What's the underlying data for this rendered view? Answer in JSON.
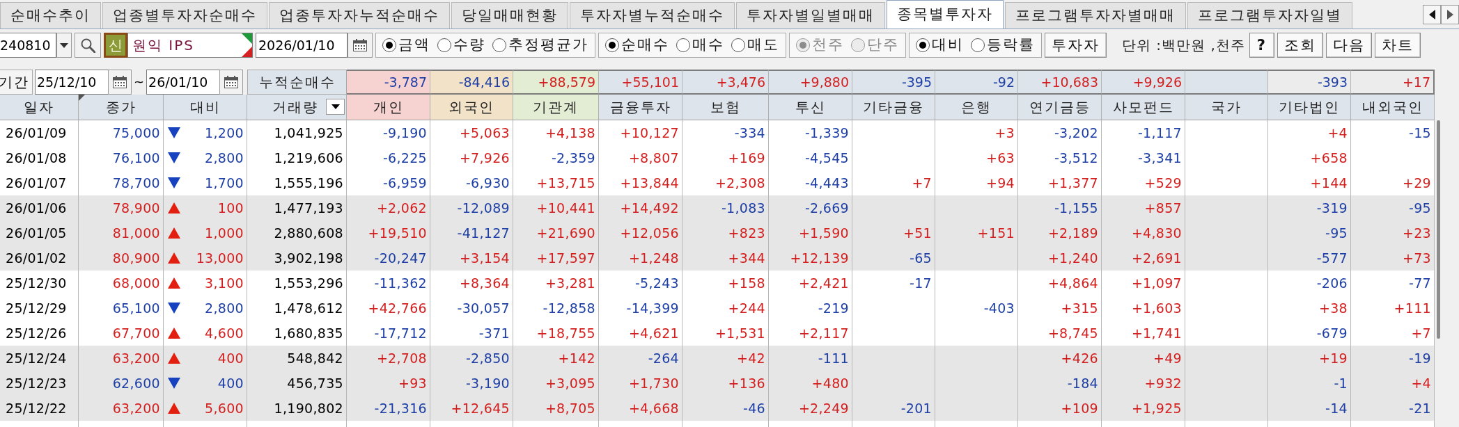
{
  "tabs": [
    {
      "label": "순매수추이",
      "selected": false
    },
    {
      "label": "업종별투자자순매수",
      "selected": false
    },
    {
      "label": "업종투자자누적순매수",
      "selected": false
    },
    {
      "label": "당일매매현황",
      "selected": false
    },
    {
      "label": "투자자별누적순매수",
      "selected": false
    },
    {
      "label": "투자자별일별매매",
      "selected": false
    },
    {
      "label": "종목별투자자",
      "selected": true
    },
    {
      "label": "프로그램투자자별매매",
      "selected": false
    },
    {
      "label": "프로그램투자자일별",
      "selected": false
    }
  ],
  "toolbar": {
    "stock_code": "240810",
    "stock_tag": "신",
    "stock_name": "원익 IPS",
    "date": "2026/01/10",
    "radio_groups": [
      {
        "disabled": false,
        "options": [
          {
            "label": "금액",
            "selected": true
          },
          {
            "label": "수량",
            "selected": false
          },
          {
            "label": "추정평균가",
            "selected": false
          }
        ]
      },
      {
        "disabled": false,
        "options": [
          {
            "label": "순매수",
            "selected": true
          },
          {
            "label": "매수",
            "selected": false
          },
          {
            "label": "매도",
            "selected": false
          }
        ]
      },
      {
        "disabled": true,
        "options": [
          {
            "label": "천주",
            "selected": true
          },
          {
            "label": "단주",
            "selected": false
          }
        ]
      },
      {
        "disabled": false,
        "options": [
          {
            "label": "대비",
            "selected": true
          },
          {
            "label": "등락률",
            "selected": false
          }
        ]
      }
    ],
    "investor_button": "투자자",
    "unit_label": "단위 :백만원 ,천주",
    "buttons": [
      "?",
      "조회",
      "다음",
      "차트"
    ]
  },
  "summary": {
    "period_label": "기간",
    "from": "25/12/10",
    "separator": "~",
    "to": "26/01/10",
    "label": "누적순매수",
    "totals": [
      {
        "value": "-3,787",
        "color": "#f6d2d0"
      },
      {
        "value": "-84,416",
        "color": "#f2e3c8"
      },
      {
        "value": "+88,579",
        "color": "#e3edd4"
      },
      {
        "value": "+55,101",
        "color": "#dde4ec"
      },
      {
        "value": "+3,476",
        "color": "#dde4ec"
      },
      {
        "value": "+9,880",
        "color": "#dde4ec"
      },
      {
        "value": "-395",
        "color": "#dde4ec"
      },
      {
        "value": "-92",
        "color": "#dde4ec"
      },
      {
        "value": "+10,683",
        "color": "#dde4ec"
      },
      {
        "value": "+9,926",
        "color": "#dde4ec"
      },
      {
        "color": "#dde4ec"
      },
      {
        "value": "-393",
        "color": "#ececec"
      },
      {
        "value": "+17",
        "color": "#ececec"
      }
    ]
  },
  "table": {
    "columns": [
      {
        "label": "일자",
        "kind": "date",
        "color": "#dde4ec"
      },
      {
        "label": "종가",
        "kind": "price",
        "color": "#dde4ec"
      },
      {
        "label": "대비",
        "kind": "change",
        "color": "#dde4ec"
      },
      {
        "label": "거래량",
        "kind": "volume",
        "color": "#dde4ec"
      },
      {
        "label": "개인",
        "kind": "investor",
        "color": "#f6d2d0"
      },
      {
        "label": "외국인",
        "kind": "investor",
        "color": "#f2e3c8"
      },
      {
        "label": "기관계",
        "kind": "investor",
        "color": "#e3edd4"
      },
      {
        "label": "금융투자",
        "kind": "investor",
        "color": "#dde4ec"
      },
      {
        "label": "보험",
        "kind": "investor",
        "color": "#dde4ec"
      },
      {
        "label": "투신",
        "kind": "investor",
        "color": "#dde4ec"
      },
      {
        "label": "기타금융",
        "kind": "investor",
        "color": "#dde4ec"
      },
      {
        "label": "은행",
        "kind": "investor",
        "color": "#dde4ec"
      },
      {
        "label": "연기금등",
        "kind": "investor",
        "color": "#dde4ec"
      },
      {
        "label": "사모펀드",
        "kind": "investor",
        "color": "#dde4ec"
      },
      {
        "label": "국가",
        "kind": "investor",
        "color": "#dde4ec"
      },
      {
        "label": "기타법인",
        "kind": "investor",
        "color": "#dde4ec"
      },
      {
        "label": "내외국인",
        "kind": "investor",
        "color": "#dde4ec"
      }
    ],
    "rows": [
      {
        "date": "26/01/09",
        "close": "75,000",
        "rising": false,
        "change": "1,200",
        "volume": "1,041,925",
        "individual": "-9,190",
        "foreign": "+5,063",
        "institutional": "+4,138",
        "financial_investment": "+10,127",
        "insurance": "-334",
        "investment_trust": "-1,339",
        "bank": "+3",
        "pension_fund": "-3,202",
        "private_fund": "-1,117",
        "other_corporate": "+4",
        "other_foreigner": "-15"
      },
      {
        "date": "26/01/08",
        "close": "76,100",
        "rising": false,
        "change": "2,800",
        "volume": "1,219,606",
        "individual": "-6,225",
        "foreign": "+7,926",
        "institutional": "-2,359",
        "financial_investment": "+8,807",
        "insurance": "+169",
        "investment_trust": "-4,545",
        "bank": "+63",
        "pension_fund": "-3,512",
        "private_fund": "-3,341",
        "other_corporate": "+658"
      },
      {
        "date": "26/01/07",
        "close": "78,700",
        "rising": false,
        "change": "1,700",
        "volume": "1,555,196",
        "individual": "-6,959",
        "foreign": "-6,930",
        "institutional": "+13,715",
        "financial_investment": "+13,844",
        "insurance": "+2,308",
        "investment_trust": "-4,443",
        "other_financial": "+7",
        "bank": "+94",
        "pension_fund": "+1,377",
        "private_fund": "+529",
        "other_corporate": "+144",
        "other_foreigner": "+29"
      },
      {
        "date": "26/01/06",
        "close": "78,900",
        "rising": true,
        "change": "100",
        "volume": "1,477,193",
        "individual": "+2,062",
        "foreign": "-12,089",
        "institutional": "+10,441",
        "financial_investment": "+14,492",
        "insurance": "-1,083",
        "investment_trust": "-2,669",
        "pension_fund": "-1,155",
        "private_fund": "+857",
        "other_corporate": "-319",
        "other_foreigner": "-95"
      },
      {
        "date": "26/01/05",
        "close": "81,000",
        "rising": true,
        "change": "1,000",
        "volume": "2,880,608",
        "individual": "+19,510",
        "foreign": "-41,127",
        "institutional": "+21,690",
        "financial_investment": "+12,056",
        "insurance": "+823",
        "investment_trust": "+1,590",
        "other_financial": "+51",
        "bank": "+151",
        "pension_fund": "+2,189",
        "private_fund": "+4,830",
        "other_corporate": "-95",
        "other_foreigner": "+23"
      },
      {
        "date": "26/01/02",
        "close": "80,900",
        "rising": true,
        "change": "13,000",
        "volume": "3,902,198",
        "individual": "-20,247",
        "foreign": "+3,154",
        "institutional": "+17,597",
        "financial_investment": "+1,248",
        "insurance": "+344",
        "investment_trust": "+12,139",
        "other_financial": "-65",
        "pension_fund": "+1,240",
        "private_fund": "+2,691",
        "other_corporate": "-577",
        "other_foreigner": "+73"
      },
      {
        "date": "25/12/30",
        "close": "68,000",
        "rising": true,
        "change": "3,100",
        "volume": "1,553,296",
        "individual": "-11,362",
        "foreign": "+8,364",
        "institutional": "+3,281",
        "financial_investment": "-5,243",
        "insurance": "+158",
        "investment_trust": "+2,421",
        "other_financial": "-17",
        "pension_fund": "+4,864",
        "private_fund": "+1,097",
        "other_corporate": "-206",
        "other_foreigner": "-77"
      },
      {
        "date": "25/12/29",
        "close": "65,100",
        "rising": false,
        "change": "2,800",
        "volume": "1,478,612",
        "individual": "+42,766",
        "foreign": "-30,057",
        "institutional": "-12,858",
        "financial_investment": "-14,399",
        "insurance": "+244",
        "investment_trust": "-219",
        "bank": "-403",
        "pension_fund": "+315",
        "private_fund": "+1,603",
        "other_corporate": "+38",
        "other_foreigner": "+111"
      },
      {
        "date": "25/12/26",
        "close": "67,700",
        "rising": true,
        "change": "4,600",
        "volume": "1,680,835",
        "individual": "-17,712",
        "foreign": "-371",
        "institutional": "+18,755",
        "financial_investment": "+4,621",
        "insurance": "+1,531",
        "investment_trust": "+2,117",
        "pension_fund": "+8,745",
        "private_fund": "+1,741",
        "other_corporate": "-679",
        "other_foreigner": "+7"
      },
      {
        "date": "25/12/24",
        "close": "63,200",
        "rising": true,
        "change": "400",
        "volume": "548,842",
        "individual": "+2,708",
        "foreign": "-2,850",
        "institutional": "+142",
        "financial_investment": "-264",
        "insurance": "+42",
        "investment_trust": "-111",
        "pension_fund": "+426",
        "private_fund": "+49",
        "other_corporate": "+19",
        "other_foreigner": "-19"
      },
      {
        "date": "25/12/23",
        "close": "62,600",
        "rising": false,
        "change": "400",
        "volume": "456,735",
        "individual": "+93",
        "foreign": "-3,190",
        "institutional": "+3,095",
        "financial_investment": "+1,730",
        "insurance": "+136",
        "investment_trust": "+480",
        "pension_fund": "-184",
        "private_fund": "+932",
        "other_corporate": "-1",
        "other_foreigner": "+4"
      },
      {
        "date": "25/12/22",
        "close": "63,200",
        "rising": true,
        "change": "5,600",
        "volume": "1,190,802",
        "individual": "-21,316",
        "foreign": "+12,645",
        "institutional": "+8,705",
        "financial_investment": "+4,668",
        "insurance": "-46",
        "investment_trust": "+2,249",
        "other_financial": "-201",
        "pension_fund": "+109",
        "private_fund": "+1,925",
        "other_corporate": "-14",
        "other_foreigner": "-21"
      }
    ]
  }
}
